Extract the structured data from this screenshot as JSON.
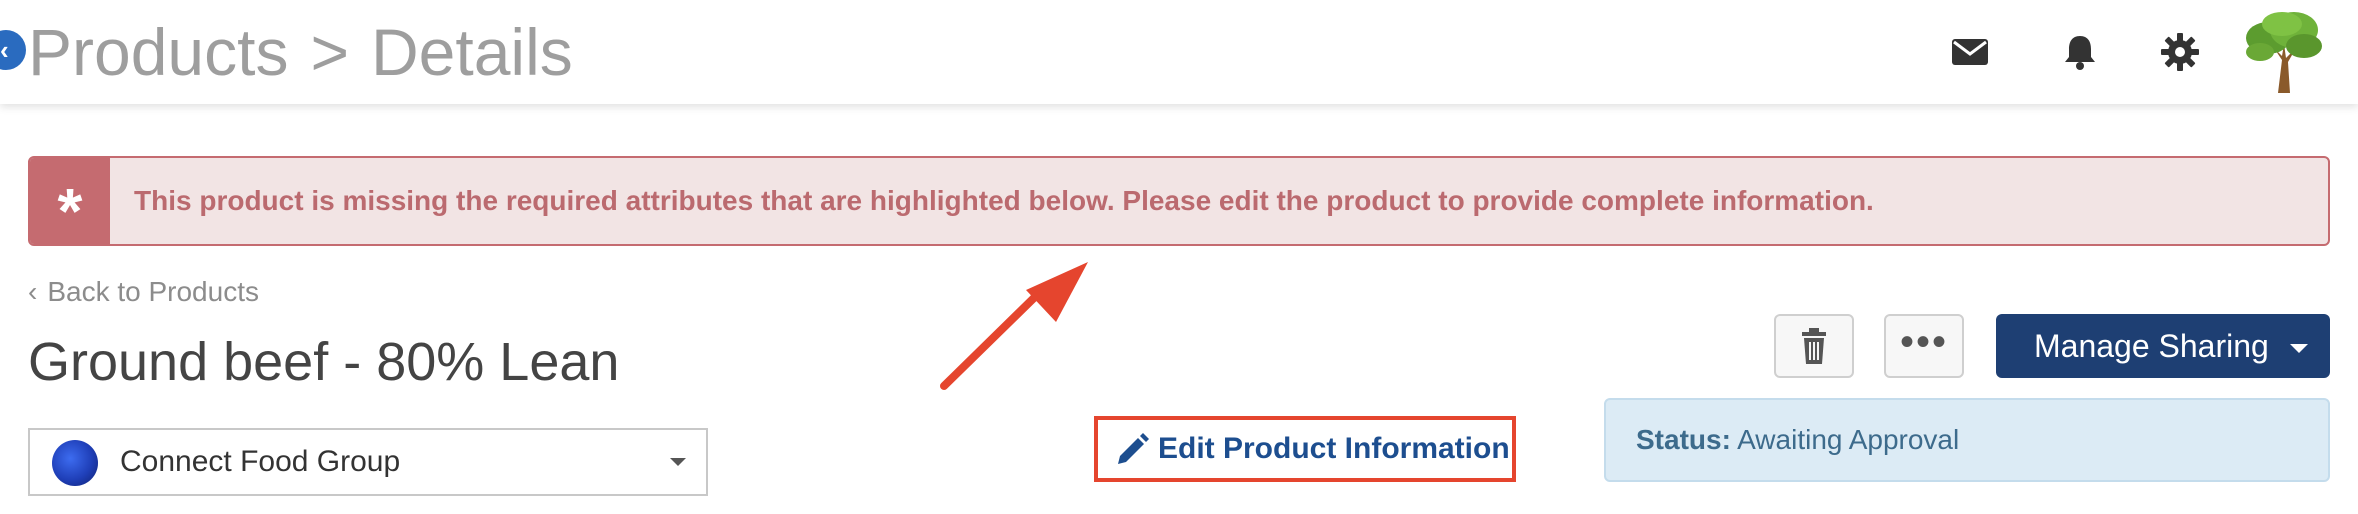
{
  "header": {
    "breadcrumb": {
      "parent": "Products",
      "separator": ">",
      "current": "Details"
    },
    "icons": {
      "mail": "envelope-icon",
      "notifications": "bell-icon",
      "settings": "gear-icon",
      "avatar": "tree-avatar"
    }
  },
  "alert": {
    "icon": "*",
    "message": "This product is missing the required attributes that are highlighted below. Please edit the product to provide complete information."
  },
  "nav": {
    "back_label": "Back to Products"
  },
  "product": {
    "title": "Ground beef - 80% Lean"
  },
  "group_selector": {
    "selected": "Connect Food Group"
  },
  "actions": {
    "edit_label": "Edit Product Information",
    "more_label": "•••",
    "share_label": "Manage Sharing"
  },
  "status": {
    "key": "Status:",
    "value": "Awaiting Approval"
  },
  "colors": {
    "alert_border": "#c56b70",
    "alert_bg": "#f2e4e4",
    "primary": "#1e3f73",
    "highlight": "#e5452e",
    "status_bg": "#dcebf5"
  }
}
